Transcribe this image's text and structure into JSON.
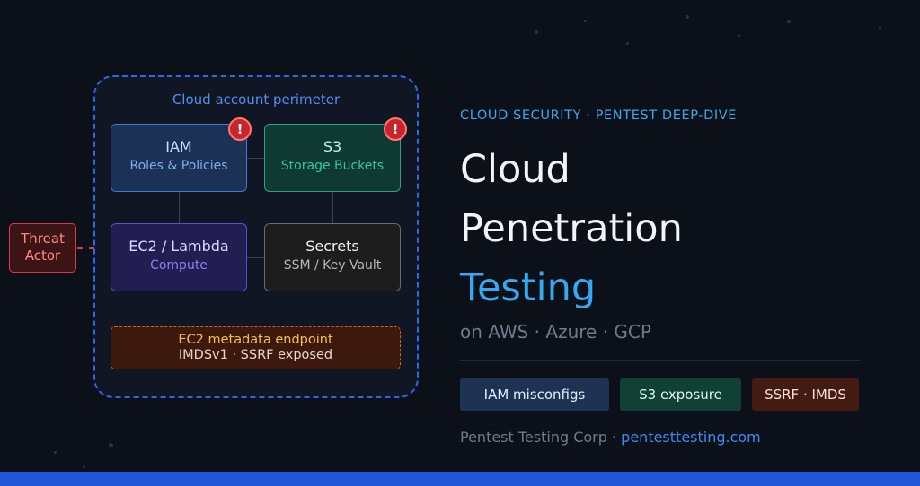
{
  "diagram": {
    "perimeter_label": "Cloud account perimeter",
    "nodes": {
      "iam": {
        "title": "IAM",
        "subtitle": "Roles & Policies",
        "alert": "!"
      },
      "s3": {
        "title": "S3",
        "subtitle": "Storage Buckets",
        "alert": "!"
      },
      "ec2": {
        "title": "EC2 / Lambda",
        "subtitle": "Compute"
      },
      "secrets": {
        "title": "Secrets",
        "subtitle": "SSM / Key Vault"
      }
    },
    "imds": {
      "title": "EC2 metadata endpoint",
      "subtitle": "IMDSv1 · SSRF exposed"
    },
    "threat_actor": {
      "line1": "Threat",
      "line2": "Actor"
    }
  },
  "hero": {
    "eyebrow": "CLOUD SECURITY · PENTEST DEEP-DIVE",
    "title_line1": "Cloud",
    "title_line2": "Penetration",
    "title_line3": "Testing",
    "subtitle": "on AWS · Azure · GCP",
    "tags": [
      "IAM misconfigs",
      "S3 exposure",
      "SSRF · IMDS"
    ],
    "footer_company": "Pentest Testing Corp · ",
    "footer_link": "pentesttesting.com"
  },
  "colors": {
    "background": "#0c1019",
    "accent_blue": "#35a9f2",
    "perimeter": "#2f67e8",
    "alert_red": "#c8242b",
    "bottom_bar": "#1f57d6"
  },
  "icons": {
    "alert": "exclamation-alert-icon"
  }
}
